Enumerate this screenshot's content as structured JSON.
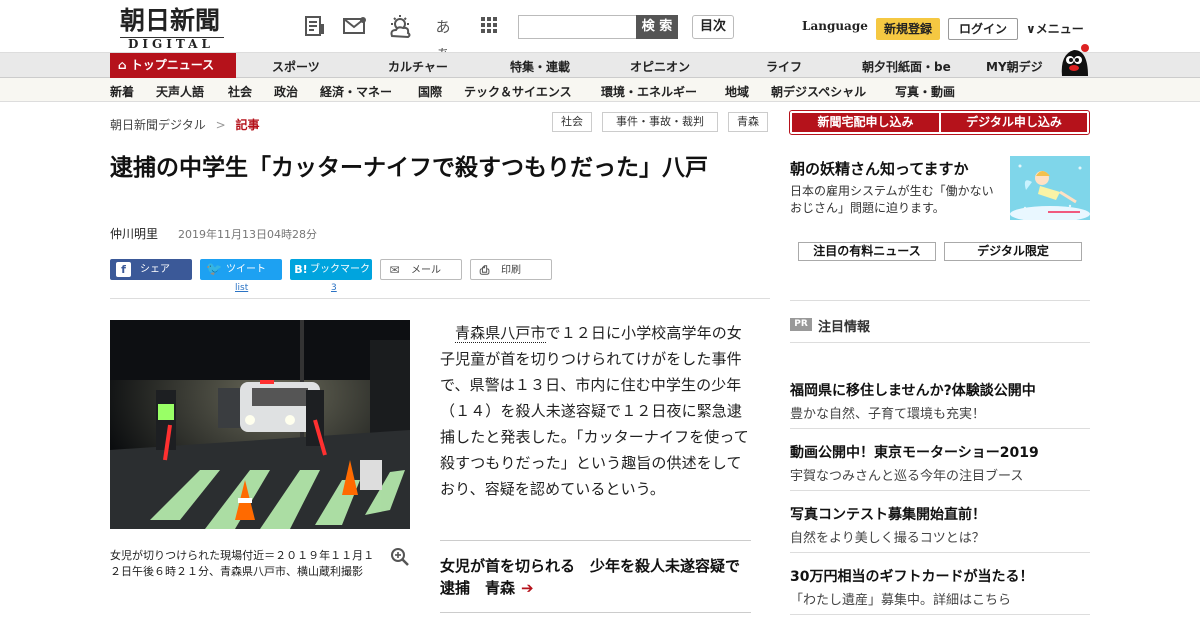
{
  "header": {
    "logo_jp": "朝日新聞",
    "logo_en": "DIGITAL",
    "icons": [
      "newspaper-icon",
      "mail-icon",
      "weather-icon",
      "font-size-icon",
      "grid-menu-icon"
    ],
    "font_icon_text": "あぁ",
    "search_placeholder": "",
    "search_button": "検 索",
    "index_button": "目次",
    "language": "Language",
    "register": "新規登録",
    "login": "ログイン",
    "menu": "メニュー"
  },
  "nav_primary": {
    "active": "トップニュース",
    "items": [
      "スポーツ",
      "カルチャー",
      "特集・連載",
      "オピニオン",
      "ライフ",
      "朝夕刊紙面・be",
      "MY朝デジ"
    ]
  },
  "nav_secondary": {
    "items": [
      "新着",
      "天声人語",
      "社会",
      "政治",
      "経済・マネー",
      "国際",
      "テック＆サイエンス",
      "環境・エネルギー",
      "地域",
      "朝デジスペシャル",
      "写真・動画"
    ]
  },
  "breadcrumb": {
    "home": "朝日新聞デジタル",
    "separator": ">",
    "current": "記事"
  },
  "tags": [
    "社会",
    "事件・事故・裁判",
    "青森"
  ],
  "article": {
    "title": "逮捕の中学生「カッターナイフで殺すつもりだった」八戸",
    "author": "仲川明里",
    "date": "2019年11月13日04時28分",
    "share": {
      "facebook": "シェア",
      "twitter": "ツイート",
      "hatena": "ブックマーク",
      "mail": "メール",
      "print": "印刷",
      "twitter_count": "list",
      "hatena_count": "3"
    },
    "photo_caption": "女児が切りつけられた現場付近＝２０１９年１１月１２日午後６時２１分、青森県八戸市、横山蔵利撮影",
    "body_link": "青森県八戸市",
    "body": "で１２日に小学校高学年の女子児童が首を切りつけられてけがをした事件で、県警は１３日、市内に住む中学生の少年（１４）を殺人未遂容疑で１２日夜に緊急逮捕したと発表した。「カッターナイフを使って殺すつもりだった」という趣旨の供述をしており、容疑を認めているという。",
    "related": "女児が首を切られる　少年を殺人未遂容疑で逮捕　青森"
  },
  "sidebar": {
    "subscribe_paper": "新聞宅配申し込み",
    "subscribe_digital": "デジタル申し込み",
    "feature_title": "朝の妖精さん知ってますか",
    "feature_text": "日本の雇用システムが生む「働かないおじさん」問題に迫ります。",
    "news_paid": "注目の有料ニュース",
    "news_digital": "デジタル限定",
    "pr_badge": "PR",
    "pr_title": "注目情報",
    "pr_items": [
      {
        "title": "福岡県に移住しませんか?体験談公開中",
        "text": "豊かな自然、子育て環境も充実！"
      },
      {
        "title": "動画公開中！東京モーターショー2019",
        "text": "宇賀なつみさんと巡る今年の注目ブース"
      },
      {
        "title": "写真コンテスト募集開始直前！",
        "text": "自然をより美しく撮るコツとは？"
      },
      {
        "title": "30万円相当のギフトカードが当たる！",
        "text": "「わたし遺産」募集中。詳細はこちら"
      }
    ]
  },
  "colors": {
    "brand_red": "#b5121b",
    "facebook": "#3b5998",
    "twitter": "#1da1f2",
    "hatena": "#00a4de",
    "register": "#f5c842"
  }
}
